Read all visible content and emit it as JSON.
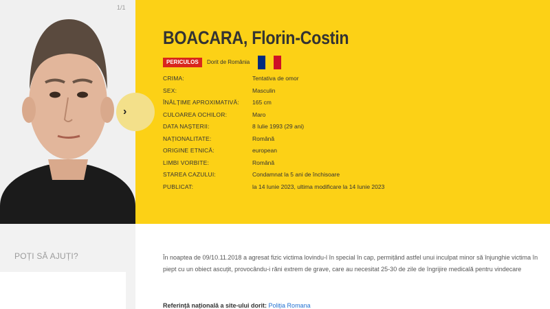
{
  "photo": {
    "counter": "1/1"
  },
  "person": {
    "name": "BOACARA, Florin-Costin",
    "status_badge": "PERICULOS",
    "wanted_by": "Dorit de România",
    "flag_colors": [
      "#002b7f",
      "#fcd116",
      "#ce1126"
    ]
  },
  "details": [
    {
      "label": "Crima:",
      "value": "Tentativa de omor"
    },
    {
      "label": "Sex:",
      "value": "Masculin"
    },
    {
      "label": "Înălțime aproximativă:",
      "value": "165 cm"
    },
    {
      "label": "Culoarea ochilor:",
      "value": "Maro"
    },
    {
      "label": "Data nașterii:",
      "value": "8 Iulie 1993 (29 ani)"
    },
    {
      "label": "Naționalitate:",
      "value": "Română"
    },
    {
      "label": "Origine etnică:",
      "value": "european"
    },
    {
      "label": "Limbi vorbite:",
      "value": "Română"
    },
    {
      "label": "Starea cazului:",
      "value": "Condamnat la 5 ani de închisoare"
    },
    {
      "label": "Publicat:",
      "value": "la 14 Iunie 2023, ultima modificare la 14 Iunie 2023"
    }
  ],
  "sidebar": {
    "help_title": "POȚI SĂ AJUȚI?"
  },
  "description": "În noaptea de 09/10.11.2018 a agresat fizic victima lovindu-l în special în cap, permițând astfel unui inculpat minor să înjunghie victima în piept cu un obiect ascuțit, provocându-i răni extrem de grave, care au necesitat 25-30 de zile de îngrijire medicală pentru vindecare",
  "reference": {
    "label": "Referință națională a site-ului dorit:",
    "link": "Poliția Romana"
  },
  "nav": {
    "next_arrow": "›"
  }
}
